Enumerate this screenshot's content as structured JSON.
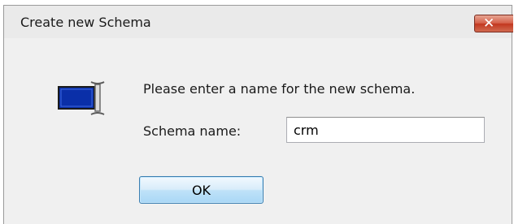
{
  "dialog": {
    "title": "Create new Schema",
    "close_glyph": "✕",
    "message": "Please enter a name for the new schema.",
    "field_label": "Schema name:",
    "field_value": "crm",
    "ok_label": "OK",
    "icon": "database-table-icon"
  },
  "colors": {
    "close_button": "#c2371f",
    "ok_border": "#3c7fb1",
    "icon_fill": "#0a2fa8"
  }
}
